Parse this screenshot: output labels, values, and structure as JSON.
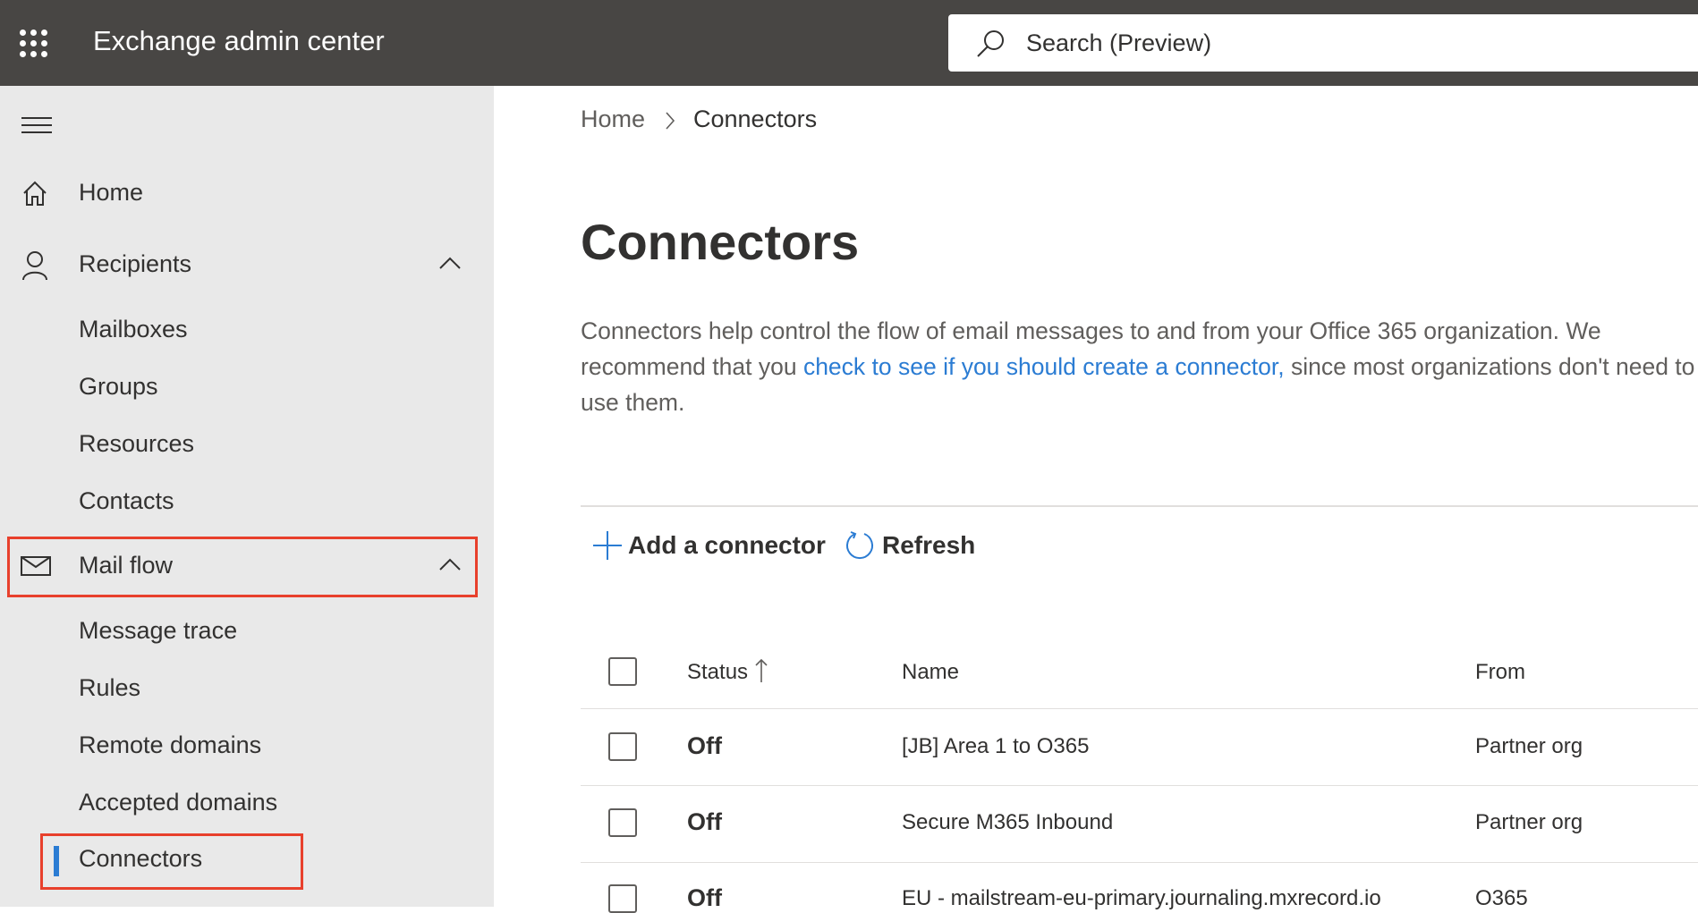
{
  "header": {
    "app_title": "Exchange admin center",
    "search_placeholder": "Search (Preview)"
  },
  "sidebar": {
    "items": [
      {
        "label": "Home"
      },
      {
        "label": "Recipients"
      },
      {
        "label": "Mailboxes"
      },
      {
        "label": "Groups"
      },
      {
        "label": "Resources"
      },
      {
        "label": "Contacts"
      },
      {
        "label": "Mail flow"
      },
      {
        "label": "Message trace"
      },
      {
        "label": "Rules"
      },
      {
        "label": "Remote domains"
      },
      {
        "label": "Accepted domains"
      },
      {
        "label": "Connectors"
      }
    ]
  },
  "breadcrumb": {
    "home": "Home",
    "current": "Connectors"
  },
  "page": {
    "title": "Connectors",
    "desc_before": "Connectors help control the flow of email messages to and from your Office 365 organization. We recommend that you ",
    "desc_link": "check to see if you should create a connector,",
    "desc_after": " since most organizations don't need to use them."
  },
  "toolbar": {
    "add_label": "Add a connector",
    "refresh_label": "Refresh"
  },
  "table": {
    "headers": {
      "status": "Status",
      "name": "Name",
      "from": "From"
    },
    "rows": [
      {
        "status": "Off",
        "name": "[JB] Area 1 to O365",
        "from": "Partner org"
      },
      {
        "status": "Off",
        "name": "Secure M365 Inbound",
        "from": "Partner org"
      },
      {
        "status": "Off",
        "name": "EU - mailstream-eu-primary.journaling.mxrecord.io",
        "from": "O365"
      }
    ]
  },
  "colors": {
    "accent": "#2b7cd3",
    "highlight": "#e8402c",
    "topbar": "#484644"
  }
}
